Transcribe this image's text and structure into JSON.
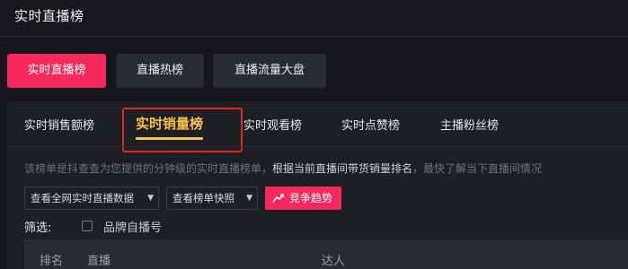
{
  "app": {
    "title": "实时直播榜"
  },
  "topnav": {
    "tabs": [
      {
        "label": "实时直播榜",
        "active": true
      },
      {
        "label": "直播热榜",
        "active": false
      },
      {
        "label": "直播流量大盘",
        "active": false
      }
    ]
  },
  "subtabs": [
    {
      "label": "实时销售额榜",
      "active": false
    },
    {
      "label": "实时销量榜",
      "active": true
    },
    {
      "label": "实时观看榜",
      "active": false
    },
    {
      "label": "实时点赞榜",
      "active": false
    },
    {
      "label": "主播粉丝榜",
      "active": false
    }
  ],
  "description": {
    "prefix": "该榜单是抖查查为您提供的分钟级的实时直播榜单，",
    "emphasis": "根据当前直播间带货销量排名",
    "suffix": "，最快了解当下直播间情况"
  },
  "controls": {
    "all_data_dropdown": "查看全网实时直播数据",
    "snapshot_dropdown": "查看榜单快照",
    "trend_button": "竞争趋势"
  },
  "filter": {
    "label": "筛选:",
    "brand_checkbox_label": "品牌自播号",
    "brand_checked": false
  },
  "table": {
    "columns": [
      "排名",
      "直播",
      "达人"
    ]
  },
  "colors": {
    "accent": "#f5295d",
    "active_subtab": "#f7c346",
    "highlight_border": "#e0261f",
    "background": "#16161c",
    "panel": "#1e1e25"
  }
}
